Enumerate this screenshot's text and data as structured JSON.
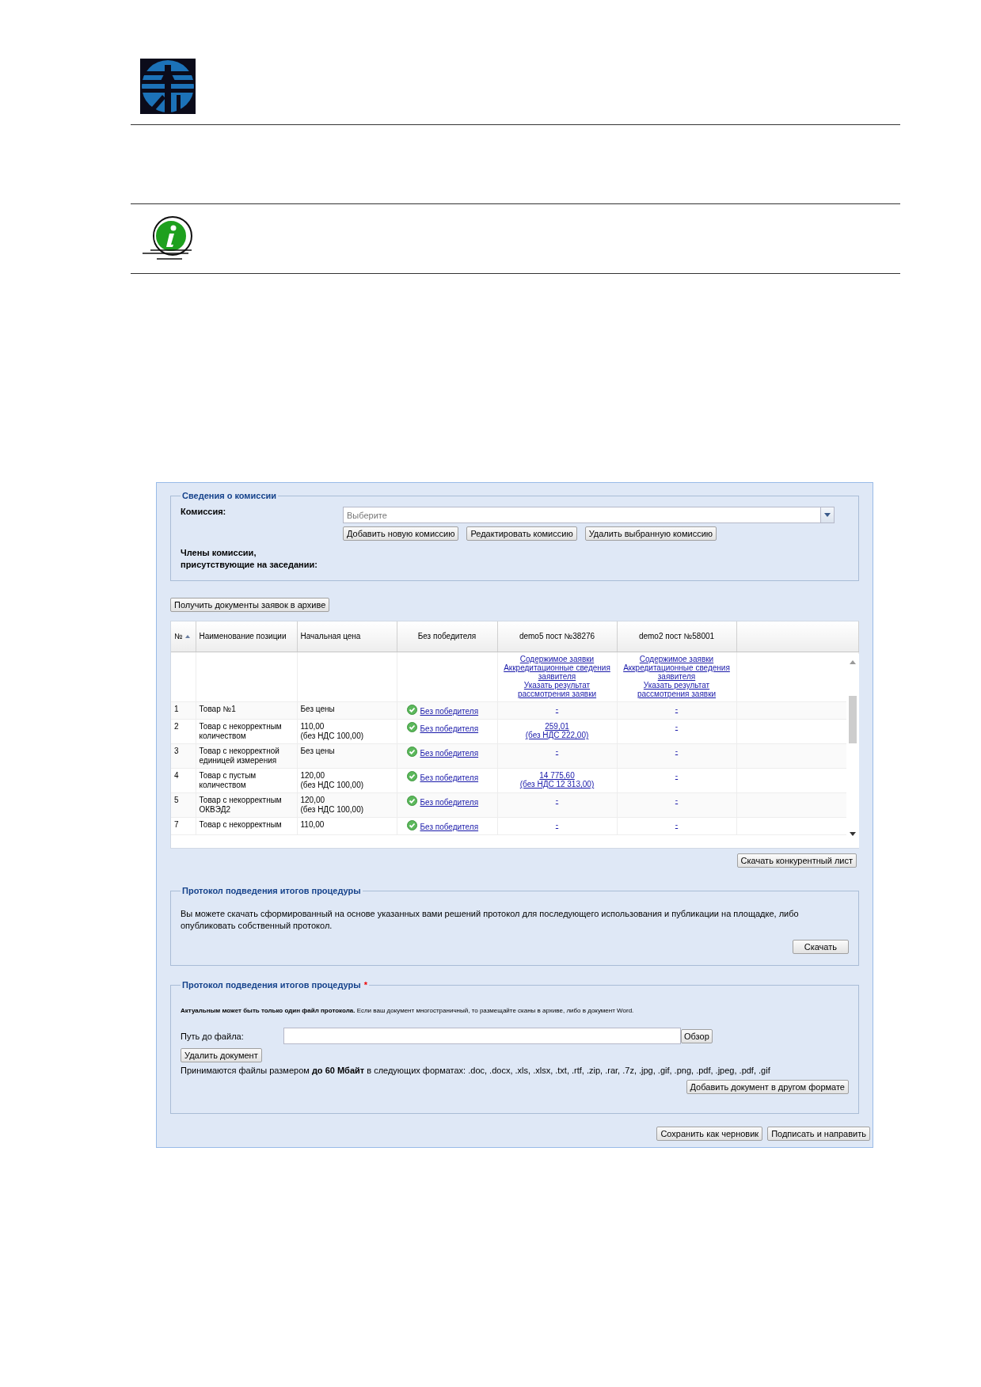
{
  "commission": {
    "legend": "Сведения о комиссии",
    "label": "Комиссия:",
    "select_placeholder": "Выберите",
    "buttons": [
      "Добавить новую комиссию",
      "Редактировать комиссию",
      "Удалить выбранную комиссию"
    ],
    "members_label": "Члены комиссии, присутствующие на заседании:"
  },
  "archive_button": "Получить документы заявок в архиве",
  "table": {
    "columns": [
      {
        "label": "№",
        "sorted": true
      },
      {
        "label": "Наименование позиции",
        "sorted": false
      },
      {
        "label": "Начальная цена",
        "sorted": false
      },
      {
        "label": "Без победителя",
        "sorted": false
      },
      {
        "label": "demo5 пост №38276",
        "sorted": false
      },
      {
        "label": "demo2 пост №58001",
        "sorted": false
      }
    ],
    "offer_links": [
      [
        "Содержимое заявки",
        "Аккредитационные сведения заявителя",
        "Указать результат рассмотрения заявки"
      ],
      [
        "Содержимое заявки",
        "Аккредитационные сведения заявителя",
        "Указать результат рассмотрения заявки"
      ]
    ],
    "rows": [
      {
        "num": "1",
        "name": "Товар №1",
        "price": "Без цены",
        "winner": "Без победителя",
        "offers": [
          {
            "value": "-"
          },
          {
            "value": "-"
          }
        ]
      },
      {
        "num": "2",
        "name": "Товар с некорректным количеством",
        "price": "110,00",
        "price_note": "(без НДС 100,00)",
        "winner": "Без победителя",
        "offers": [
          {
            "value": "259,01",
            "note": "(без НДС 222,00)"
          },
          {
            "value": "-"
          }
        ]
      },
      {
        "num": "3",
        "name": "Товар с некорректной единицей измерения",
        "price": "Без цены",
        "winner": "Без победителя",
        "offers": [
          {
            "value": "-"
          },
          {
            "value": "-"
          }
        ]
      },
      {
        "num": "4",
        "name": "Товар с пустым количеством",
        "price": "120,00",
        "price_note": "(без НДС 100,00)",
        "winner": "Без победителя",
        "offers": [
          {
            "value": "14 775,60",
            "note": "(без НДС 12 313,00)"
          },
          {
            "value": "-"
          }
        ]
      },
      {
        "num": "5",
        "name": "Товар с некорректным ОКВЭД2",
        "price": "120,00",
        "price_note": "(без НДС 100,00)",
        "winner": "Без победителя",
        "offers": [
          {
            "value": "-"
          },
          {
            "value": "-"
          }
        ]
      },
      {
        "num": "7",
        "name": "Товар с некорректным",
        "price": "110,00",
        "winner": "Без победителя",
        "offers": [
          {
            "value": "-"
          },
          {
            "value": "-"
          }
        ]
      }
    ]
  },
  "competitive_sheet_button": "Скачать конкурентный лист",
  "protocol_download": {
    "legend": "Протокол подведения итогов процедуры",
    "text": "Вы можете скачать сформированный на основе указанных вами решений протокол для последующего использования и публикации на площадке, либо опубликовать собственный протокол.",
    "button": "Скачать"
  },
  "protocol_upload": {
    "legend": "Протокол подведения итогов процедуры",
    "required_mark": "*",
    "note": "**Актуальным может быть только один файл протокола.** Если ваш документ многостраничный, то размещайте сканы в архиве, либо в документ Word.",
    "file_label": "Путь до файла:",
    "browse_button": "Обзор",
    "delete_button": "Удалить документ",
    "formats": "Принимаются файлы размером **до 60 Мбайт** в следующих форматах: .doc, .docx, .xls, .xlsx, .txt, .rtf, .zip, .rar, .7z, .jpg, .gif, .png, .pdf, .jpeg, .pdf, .gif",
    "add_button": "Добавить документ в другом формате"
  },
  "footer_buttons": [
    "Сохранить как черновик",
    "Подписать и направить"
  ]
}
